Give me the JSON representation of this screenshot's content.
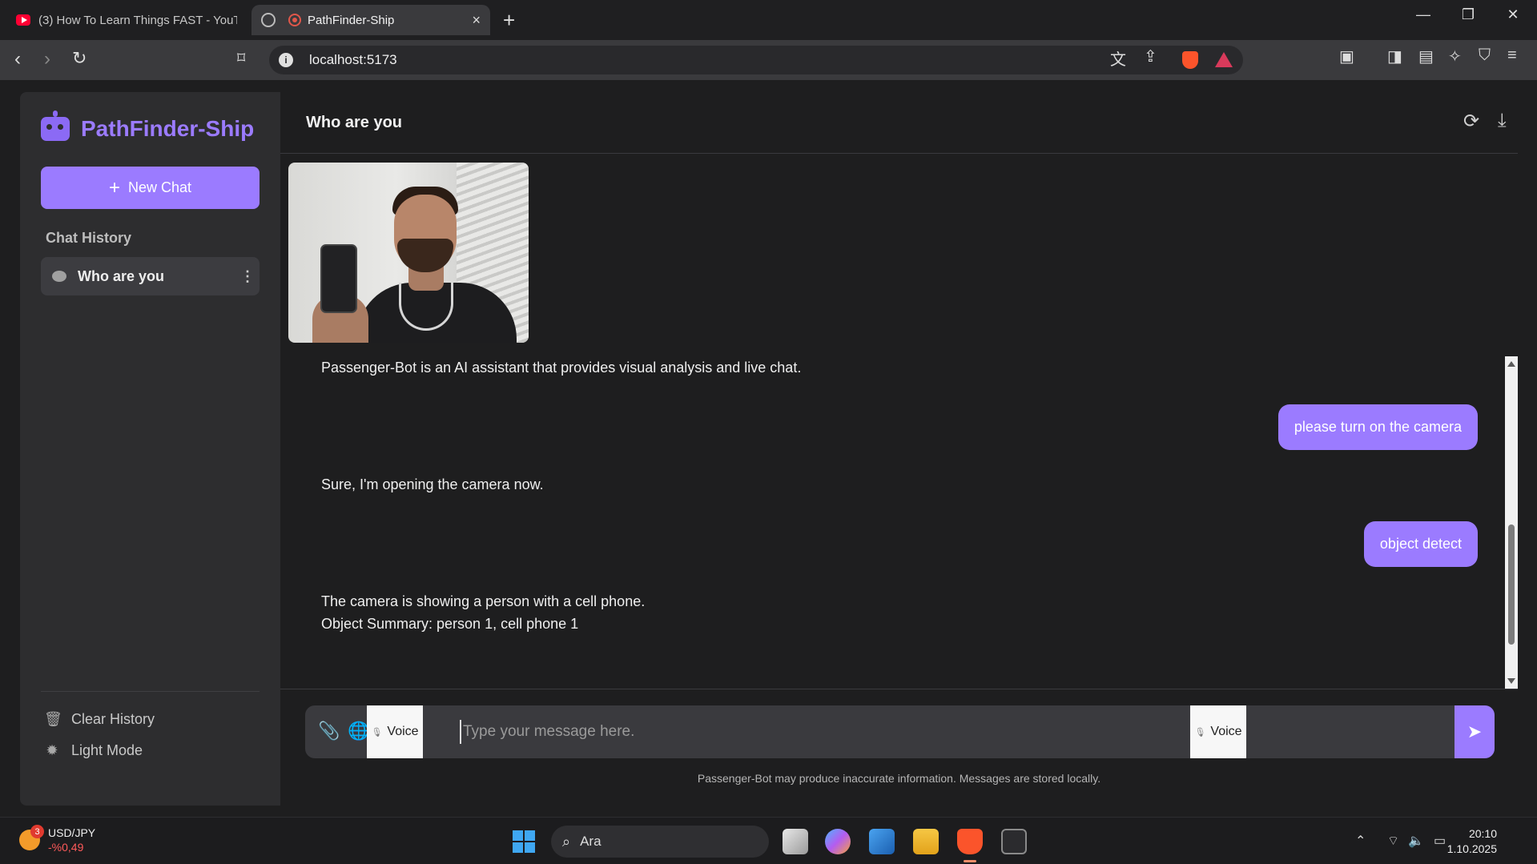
{
  "browser": {
    "tabs": [
      {
        "title": "(3) How To Learn Things FAST - YouTube",
        "active": false
      },
      {
        "title": "PathFinder-Ship",
        "active": true
      }
    ],
    "new_tab": "+",
    "url": "localhost:5173",
    "window_controls": {
      "minimize": "—",
      "restore": "❐",
      "close": "✕"
    }
  },
  "sidebar": {
    "brand": "PathFinder-Ship",
    "new_chat_label": "New Chat",
    "history_title": "Chat History",
    "history_items": [
      {
        "label": "Who are you"
      }
    ],
    "actions": [
      {
        "label": "Clear History",
        "icon": "trash-icon"
      },
      {
        "label": "Light Mode",
        "icon": "sun-icon"
      }
    ]
  },
  "chat": {
    "title": "Who are you",
    "messages": [
      {
        "role": "bot",
        "text": "Passenger-Bot is an AI assistant that provides visual analysis and live chat."
      },
      {
        "role": "user",
        "text": "please turn on the camera"
      },
      {
        "role": "bot",
        "text": "Sure, I'm opening the camera now."
      },
      {
        "role": "user",
        "text": "object detect"
      },
      {
        "role": "bot",
        "text": "The camera is showing a person with a cell phone."
      },
      {
        "role": "bot",
        "text": "Object Summary: person 1, cell phone 1"
      }
    ],
    "composer": {
      "placeholder": "Type your message here.",
      "voice_left": "Voice",
      "voice_right": "Voice"
    },
    "disclaimer": "Passenger-Bot may produce inaccurate information. Messages are stored locally."
  },
  "taskbar": {
    "ticker_symbol": "USD/JPY",
    "ticker_change": "-%0,49",
    "ticker_badge": "3",
    "search_label": "Ara",
    "time": "20:10",
    "date": "1.10.2025"
  },
  "colors": {
    "accent": "#9b7bff",
    "sidebar_bg": "#2d2d2f",
    "main_bg": "#1e1e1f"
  }
}
